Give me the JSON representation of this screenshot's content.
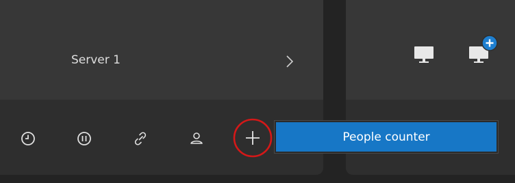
{
  "server": {
    "name": "Server 1"
  },
  "toolbar": {
    "icons": [
      "clock-icon",
      "pause-icon",
      "link-icon",
      "user-icon",
      "plus-icon"
    ]
  },
  "menu": {
    "items": [
      {
        "label": "People counter"
      }
    ]
  },
  "colors": {
    "background": "#232323",
    "panel": "#2e2e2e",
    "panel_header": "#373737",
    "accent": "#1777c6",
    "highlight_ring": "#d41818"
  }
}
